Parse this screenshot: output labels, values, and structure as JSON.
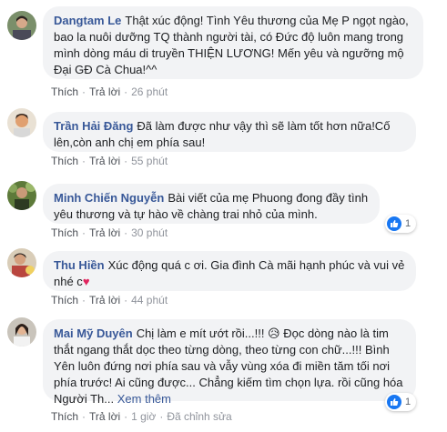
{
  "comments": [
    {
      "author": "Dangtam Le",
      "text": "Thật xúc động! Tình Yêu thương của Mẹ P ngọt ngào, bao la nuôi dưỡng TQ thành người tài, có Đức độ luôn mang trong mình dòng máu di truyền THIỆN LƯƠNG! Mến yêu và ngưỡng mộ Đại GĐ Cà Chua!^^",
      "like_label": "Thích",
      "reply_label": "Trả lời",
      "time": "26 phút"
    },
    {
      "author": "Trần Hải Đăng",
      "text": "Đã làm được như vậy thì sẽ làm tốt hơn nữa!Cố lên,còn anh chị em phía sau!",
      "like_label": "Thích",
      "reply_label": "Trả lời",
      "time": "55 phút"
    },
    {
      "author": "Minh Chiến Nguyễn",
      "text": "Bài viết của mẹ Phuong đong đầy tình yêu thương và tự hào về chàng trai nhỏ của mình.",
      "like_label": "Thích",
      "reply_label": "Trả lời",
      "time": "30 phút",
      "reaction_count": "1"
    },
    {
      "author": "Thu Hiền",
      "text": "Xúc động quá c ơi. Gia đình Cà mãi hạnh phúc và vui vẻ nhé c",
      "emoji": "♥",
      "like_label": "Thích",
      "reply_label": "Trả lời",
      "time": "44 phút"
    },
    {
      "author": "Mai Mỹ Duyên",
      "text": "Chị làm e mít ướt rồi...!!! 😥 Đọc dòng nào là tim thắt ngang thắt dọc theo từng dòng, theo từng con chữ...!!! Bình Yên luôn đứng nơi phía sau và vẫy vùng xóa đi miền tăm tối nơi phía trước! Ai cũng được... Chẳng kiếm tìm chọn lựa. rồi cũng hóa Người Th...",
      "see_more": "Xem thêm",
      "like_label": "Thích",
      "reply_label": "Trả lời",
      "time": "1 giờ",
      "edited": "Đã chỉnh sửa",
      "reaction_count": "1"
    }
  ],
  "colors": {
    "author": "#385898",
    "bubble": "#f2f3f5",
    "like_blue": "#1877f2",
    "heart": "#e0245e"
  },
  "icons": [
    "avatar",
    "like-icon",
    "heart-icon"
  ]
}
